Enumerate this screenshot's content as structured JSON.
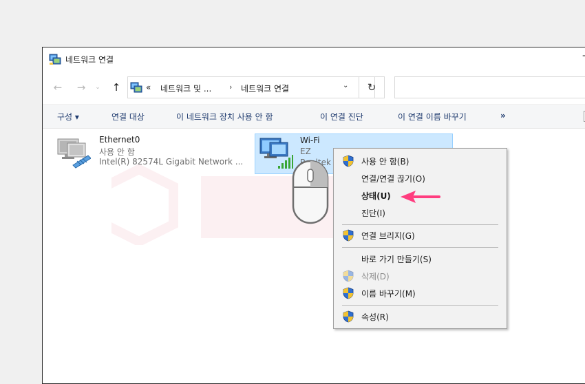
{
  "window": {
    "title": "네트워크 연결",
    "minimize": "–"
  },
  "addressbar": {
    "back": "←",
    "forward": "→",
    "recent": "⌄",
    "up": "↑",
    "overflow": "«",
    "crumb1": "네트워크 및 ...",
    "crumb2": "네트워크 연결",
    "separator": "›",
    "dropdown": "⌄",
    "refresh": "↻"
  },
  "commandbar": {
    "organize": "구성 ▾",
    "items": [
      "연결 대상",
      "이 네트워크 장치 사용 안 함",
      "이 연결 진단",
      "이 연결 이름 바꾸기",
      "»"
    ]
  },
  "adapters": {
    "ethernet": {
      "name": "Ethernet0",
      "status": "사용 안 함",
      "device": "Intel(R) 82574L Gigabit Network ..."
    },
    "wifi": {
      "name": "Wi-Fi",
      "status": "EZ",
      "device": "Realtek"
    }
  },
  "context_menu": {
    "items": [
      {
        "label": "사용 안 함(B)",
        "shield": true
      },
      {
        "label": "연결/연결 끊기(O)",
        "shield": false
      },
      {
        "label": "상태(U)",
        "shield": false,
        "bold": true
      },
      {
        "label": "진단(I)",
        "shield": false
      },
      {
        "label": "연결 브리지(G)",
        "shield": true
      },
      {
        "label": "바로 가기 만들기(S)",
        "shield": false
      },
      {
        "label": "삭제(D)",
        "shield": true,
        "disabled": true
      },
      {
        "label": "이름 바꾸기(M)",
        "shield": true
      },
      {
        "label": "속성(R)",
        "shield": true
      }
    ]
  },
  "colors": {
    "selection": "#cce8ff",
    "selection_border": "#99d1ff",
    "arrow": "#ff3d7f",
    "command_text": "#1e3a6e"
  }
}
